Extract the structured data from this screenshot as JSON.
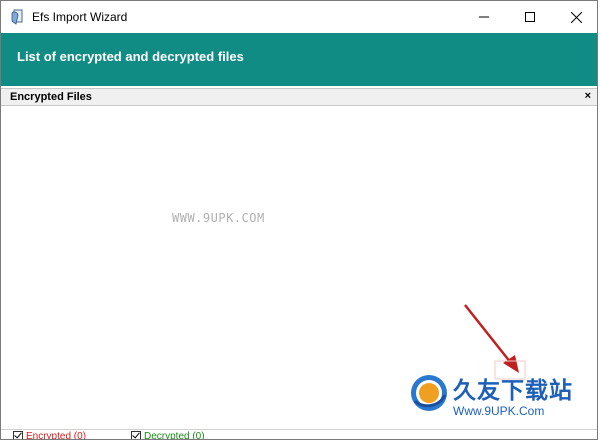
{
  "window": {
    "title": "Efs Import Wizard"
  },
  "banner": {
    "text": "List of encrypted and decrypted files"
  },
  "panel": {
    "title": "Encrypted Files",
    "close_glyph": "×"
  },
  "file_list": {
    "items": []
  },
  "watermark": {
    "text": "WWW.9UPK.COM"
  },
  "logo": {
    "cn_text": "久友下载站",
    "url": "Www.9UPK.Com"
  },
  "statusbar": {
    "encrypted": {
      "label": "Encrypted (0)",
      "checked": true
    },
    "decrypted": {
      "label": "Decrypted (0)",
      "checked": true
    }
  },
  "colors": {
    "banner": "#108c84",
    "encrypted": "#d42020",
    "decrypted": "#1a8a1a",
    "logo": "#1e5fb8"
  }
}
